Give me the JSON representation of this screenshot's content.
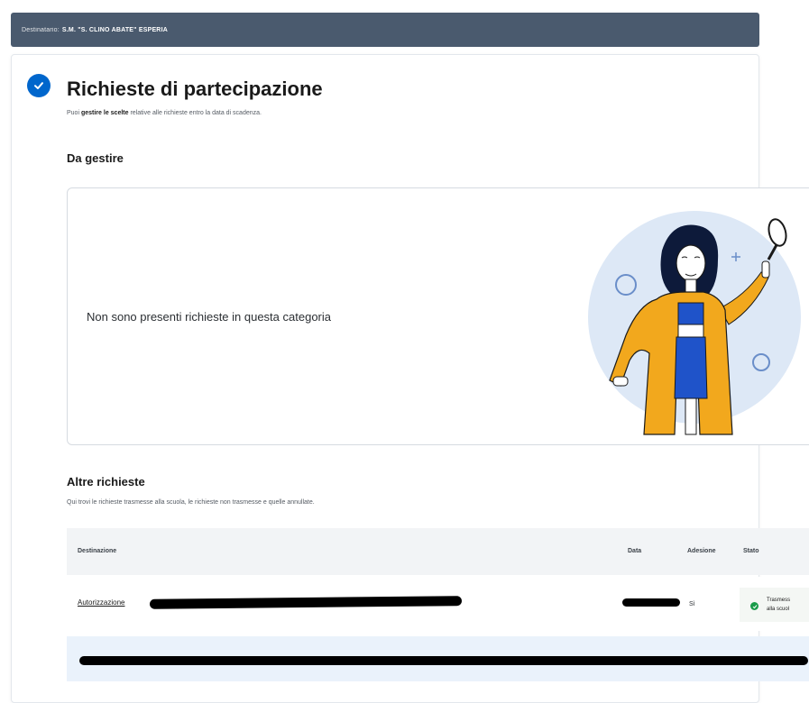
{
  "top_bar": {
    "label": "Destinatario:",
    "value": "S.M. \"S. CLINO ABATE\" ESPERIA"
  },
  "page": {
    "title": "Richieste di partecipazione",
    "subtitle_prefix": "Puoi ",
    "subtitle_bold": "gestire le scelte",
    "subtitle_suffix": " relative alle richieste entro la data di scadenza."
  },
  "manage_section": {
    "heading": "Da gestire",
    "empty_message": "Non sono presenti richieste in questa categoria"
  },
  "other_section": {
    "heading": "Altre richieste",
    "description": "Qui trovi le richieste trasmesse alla scuola, le richieste non trasmesse e quelle annullate."
  },
  "table": {
    "headers": {
      "destination": "Destinazione",
      "date": "Data",
      "adhesion": "Adesione",
      "status": "Stato"
    },
    "rows": [
      {
        "destination_prefix": "Autorizzazione",
        "adhesion": "Sì",
        "status_line1": "Trasmess",
        "status_line2": "alla scuol"
      }
    ]
  },
  "colors": {
    "top_bar": "#4a5a6e",
    "check_blue": "#0066cc",
    "status_green": "#1a9c4a",
    "row_highlight": "#eaf2fb"
  }
}
